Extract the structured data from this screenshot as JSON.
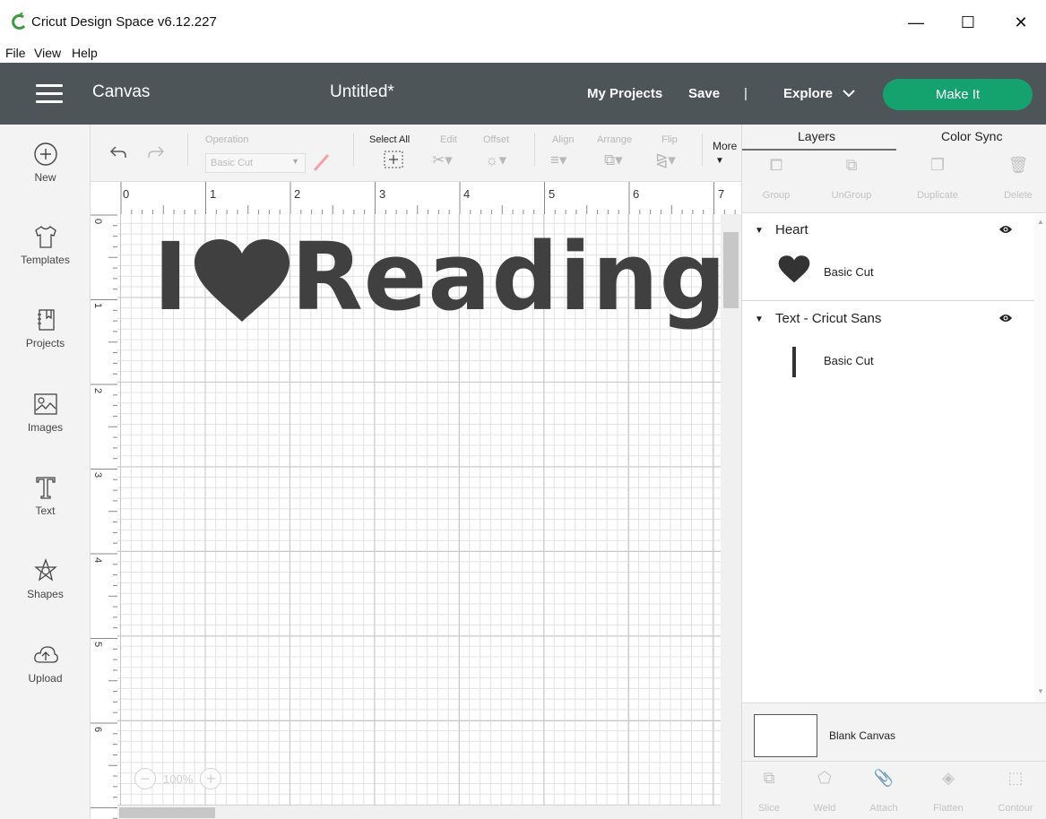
{
  "window": {
    "title": "Cricut Design Space  v6.12.227",
    "controls": {
      "minimize": "—",
      "maximize": "☐",
      "close": "✕"
    }
  },
  "menu": [
    "File",
    "View",
    "Help"
  ],
  "header": {
    "section": "Canvas",
    "project_title": "Untitled*",
    "my_projects": "My Projects",
    "save": "Save",
    "separator": "|",
    "explore": "Explore",
    "make_it": "Make It",
    "make_it_color": "#14a36e"
  },
  "sidebar": {
    "items": [
      {
        "label": "New",
        "icon": "plus-circle-icon"
      },
      {
        "label": "Templates",
        "icon": "tshirt-icon"
      },
      {
        "label": "Projects",
        "icon": "notebook-icon"
      },
      {
        "label": "Images",
        "icon": "image-icon"
      },
      {
        "label": "Text",
        "icon": "text-t-icon"
      },
      {
        "label": "Shapes",
        "icon": "shapes-icon"
      },
      {
        "label": "Upload",
        "icon": "cloud-upload-icon"
      }
    ]
  },
  "toolbar": {
    "operation_label": "Operation",
    "operation_value": "Basic Cut",
    "select_all": "Select All",
    "edit": "Edit",
    "offset": "Offset",
    "align": "Align",
    "arrange": "Arrange",
    "flip": "Flip",
    "more": "More"
  },
  "ruler": {
    "h": [
      "0",
      "1",
      "2",
      "3",
      "4",
      "5",
      "6",
      "7"
    ],
    "v": [
      "0",
      "1",
      "2",
      "3",
      "4",
      "5",
      "6"
    ]
  },
  "design": {
    "text_before": "I",
    "text_after": "Reading",
    "fill": "#404040"
  },
  "zoom": {
    "minus": "−",
    "level": "100%",
    "plus": "+"
  },
  "right_panel": {
    "tabs": [
      "Layers",
      "Color Sync"
    ],
    "actions": [
      "Group",
      "UnGroup",
      "Duplicate",
      "Delete"
    ],
    "layers": [
      {
        "name": "Heart",
        "child": "Basic Cut",
        "thumb": "heart-icon"
      },
      {
        "name": "Text - Cricut Sans",
        "child": "Basic Cut",
        "thumb": "text-bar-icon"
      }
    ],
    "blank_canvas": "Blank Canvas",
    "bottom_actions": [
      "Slice",
      "Weld",
      "Attach",
      "Flatten",
      "Contour"
    ]
  }
}
